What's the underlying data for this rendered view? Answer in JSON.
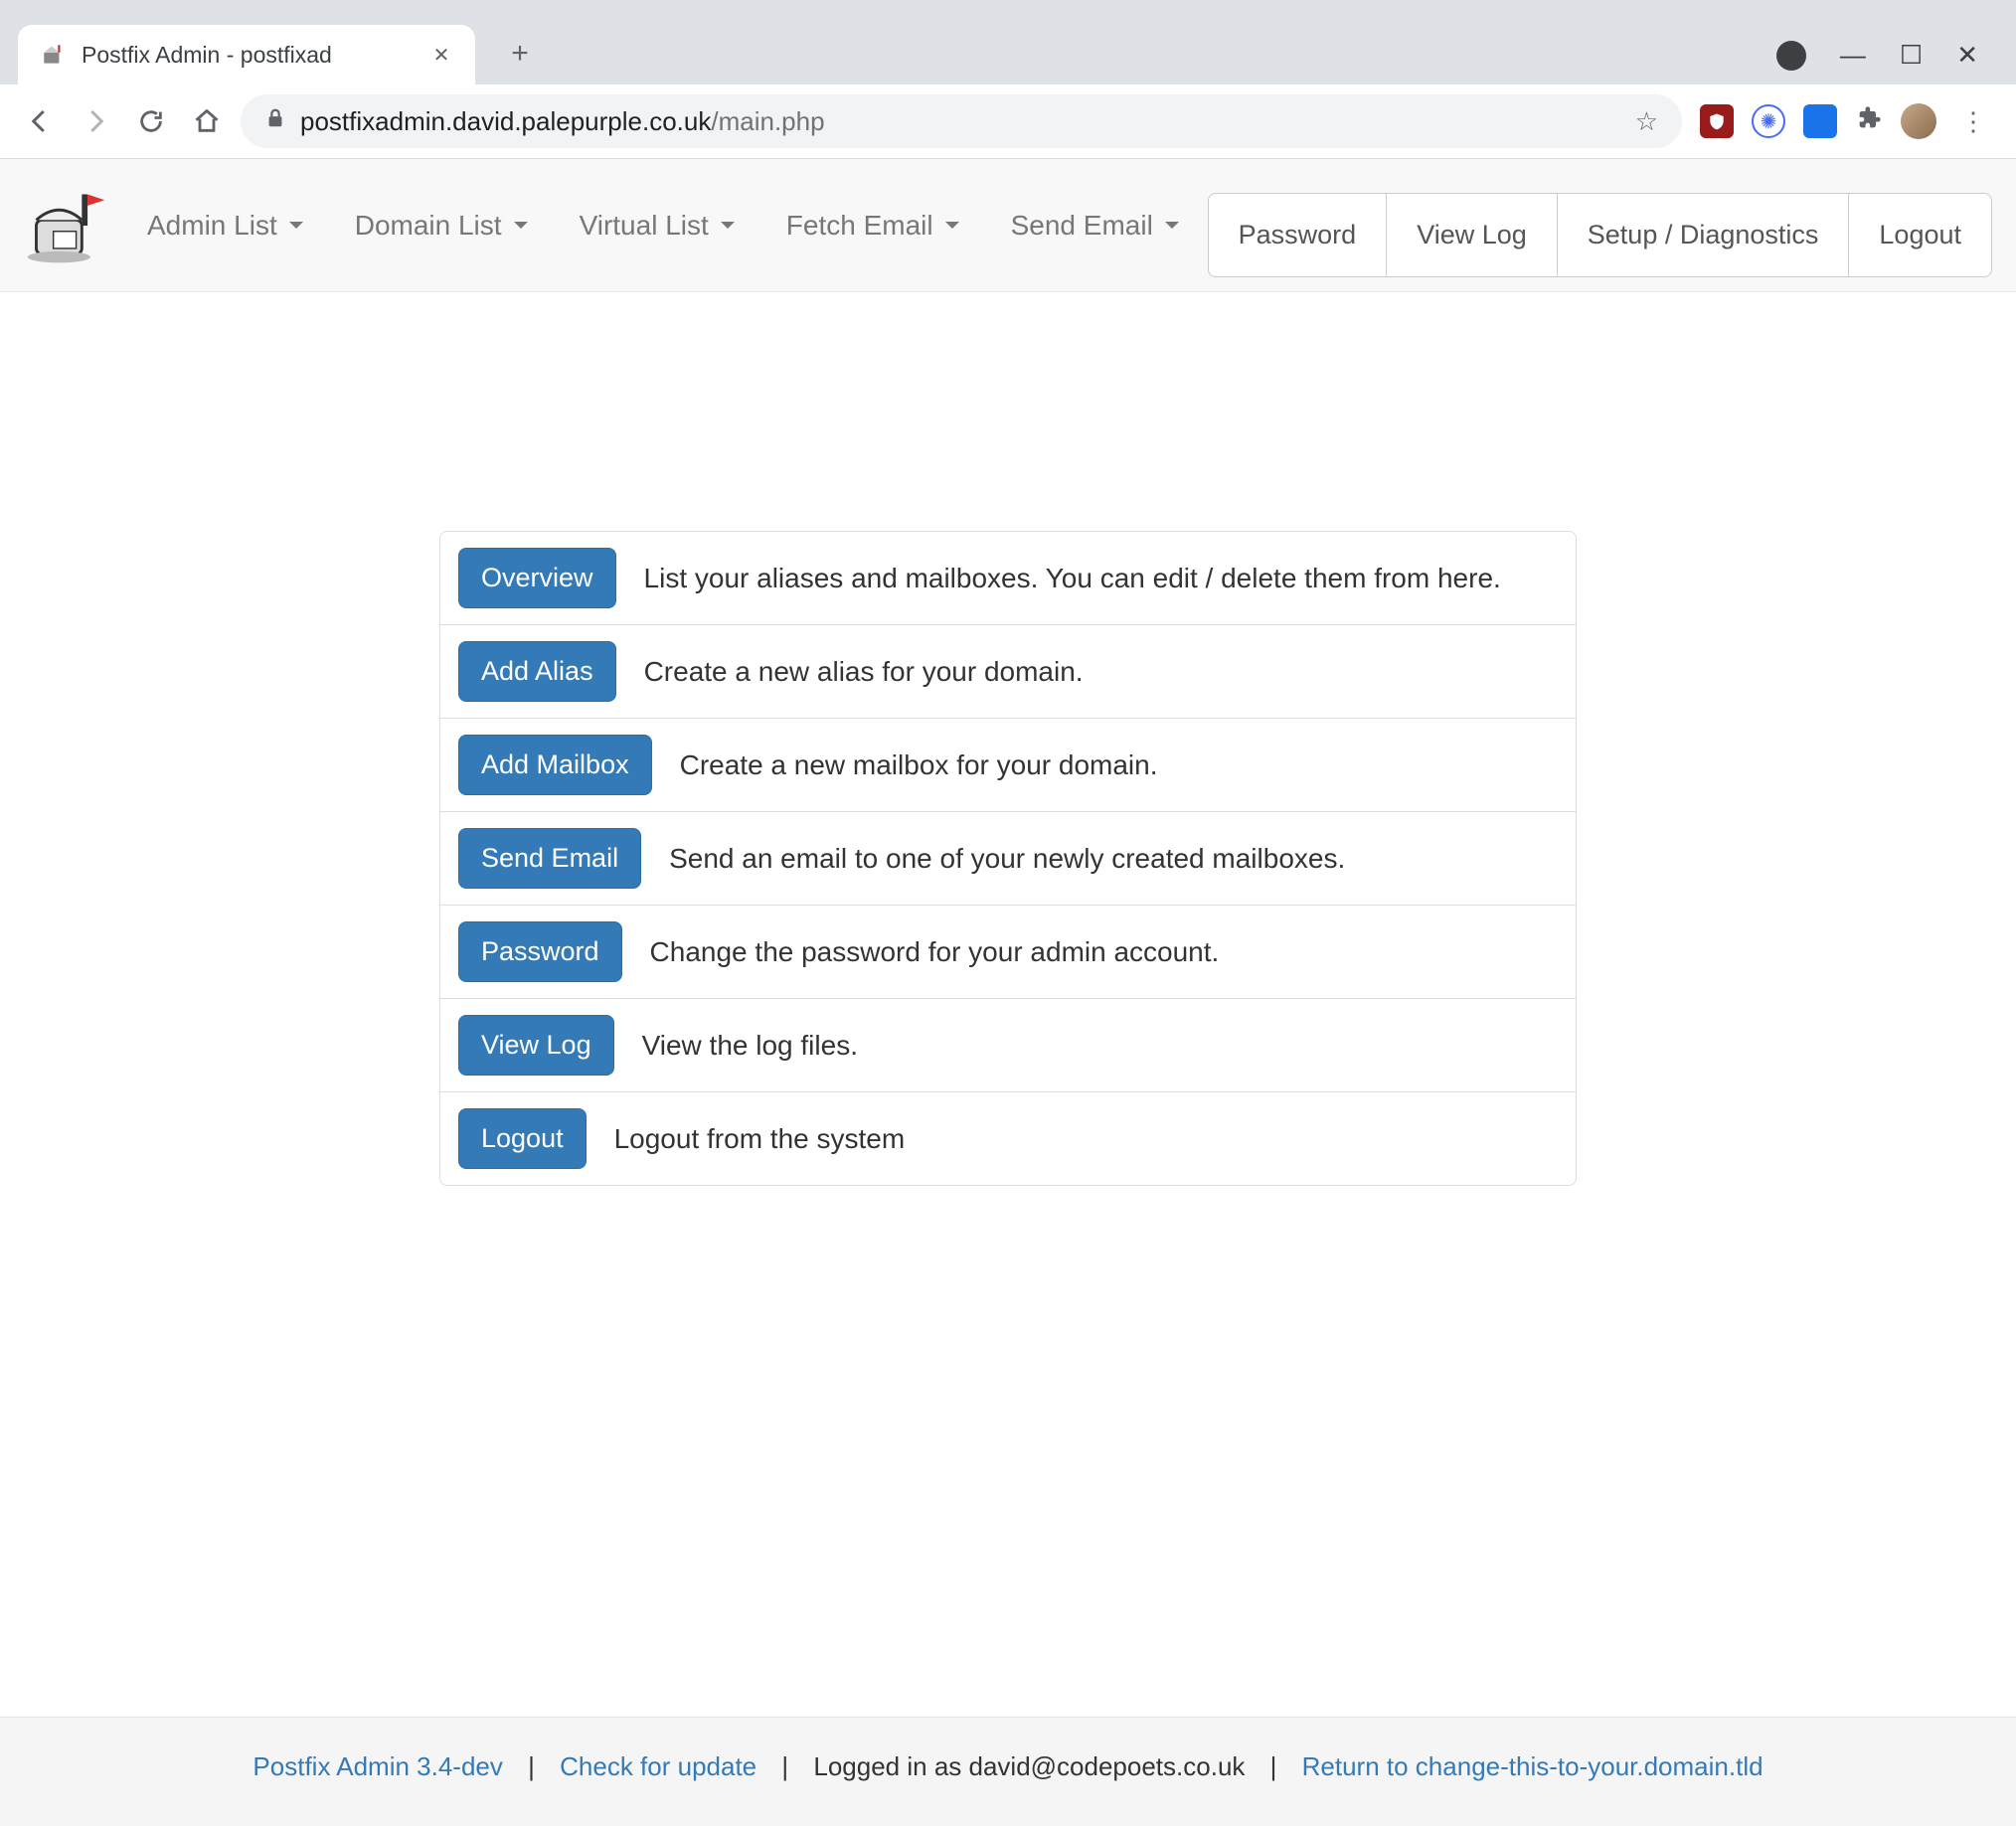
{
  "browser": {
    "tab_title": "Postfix Admin - postfixad",
    "url_host": "postfixadmin.david.palepurple.co.uk",
    "url_path": "/main.php"
  },
  "nav": {
    "items": [
      "Admin List",
      "Domain List",
      "Virtual List",
      "Fetch Email",
      "Send Email"
    ],
    "right": [
      "Password",
      "View Log",
      "Setup / Diagnostics",
      "Logout"
    ]
  },
  "panel": [
    {
      "btn": "Overview",
      "desc": "List your aliases and mailboxes. You can edit / delete them from here."
    },
    {
      "btn": "Add Alias",
      "desc": "Create a new alias for your domain."
    },
    {
      "btn": "Add Mailbox",
      "desc": "Create a new mailbox for your domain."
    },
    {
      "btn": "Send Email",
      "desc": "Send an email to one of your newly created mailboxes."
    },
    {
      "btn": "Password",
      "desc": "Change the password for your admin account."
    },
    {
      "btn": "View Log",
      "desc": "View the log files."
    },
    {
      "btn": "Logout",
      "desc": "Logout from the system"
    }
  ],
  "footer": {
    "version": "Postfix Admin 3.4-dev",
    "check": "Check for update",
    "logged": "Logged in as david@codepoets.co.uk",
    "return": "Return to change-this-to-your.domain.tld"
  }
}
